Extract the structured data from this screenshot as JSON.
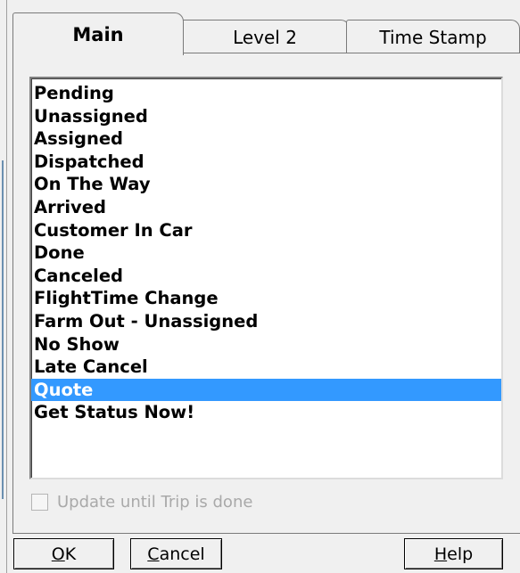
{
  "tabs": [
    {
      "label": "Main",
      "active": true
    },
    {
      "label": "Level 2",
      "active": false
    },
    {
      "label": "Time Stamp",
      "active": false
    }
  ],
  "status_list": {
    "items": [
      "Pending",
      "Unassigned",
      "Assigned",
      "Dispatched",
      "On The Way",
      "Arrived",
      "Customer In Car",
      "Done",
      "Canceled",
      "FlightTime Change",
      "Farm Out - Unassigned",
      "No Show",
      "Late Cancel",
      "Quote",
      "Get Status Now!"
    ],
    "selected": "Quote"
  },
  "update_checkbox": {
    "label": "Update until Trip is done",
    "checked": false,
    "disabled": true
  },
  "buttons": {
    "ok": {
      "mnemonic": "O",
      "rest": "K"
    },
    "cancel": {
      "mnemonic": "C",
      "rest": "ancel"
    },
    "help": {
      "mnemonic": "H",
      "rest": "elp"
    }
  },
  "colors": {
    "selection": "#3399ff",
    "background": "#f0f0f0",
    "disabled_text": "#a9a9a9"
  }
}
